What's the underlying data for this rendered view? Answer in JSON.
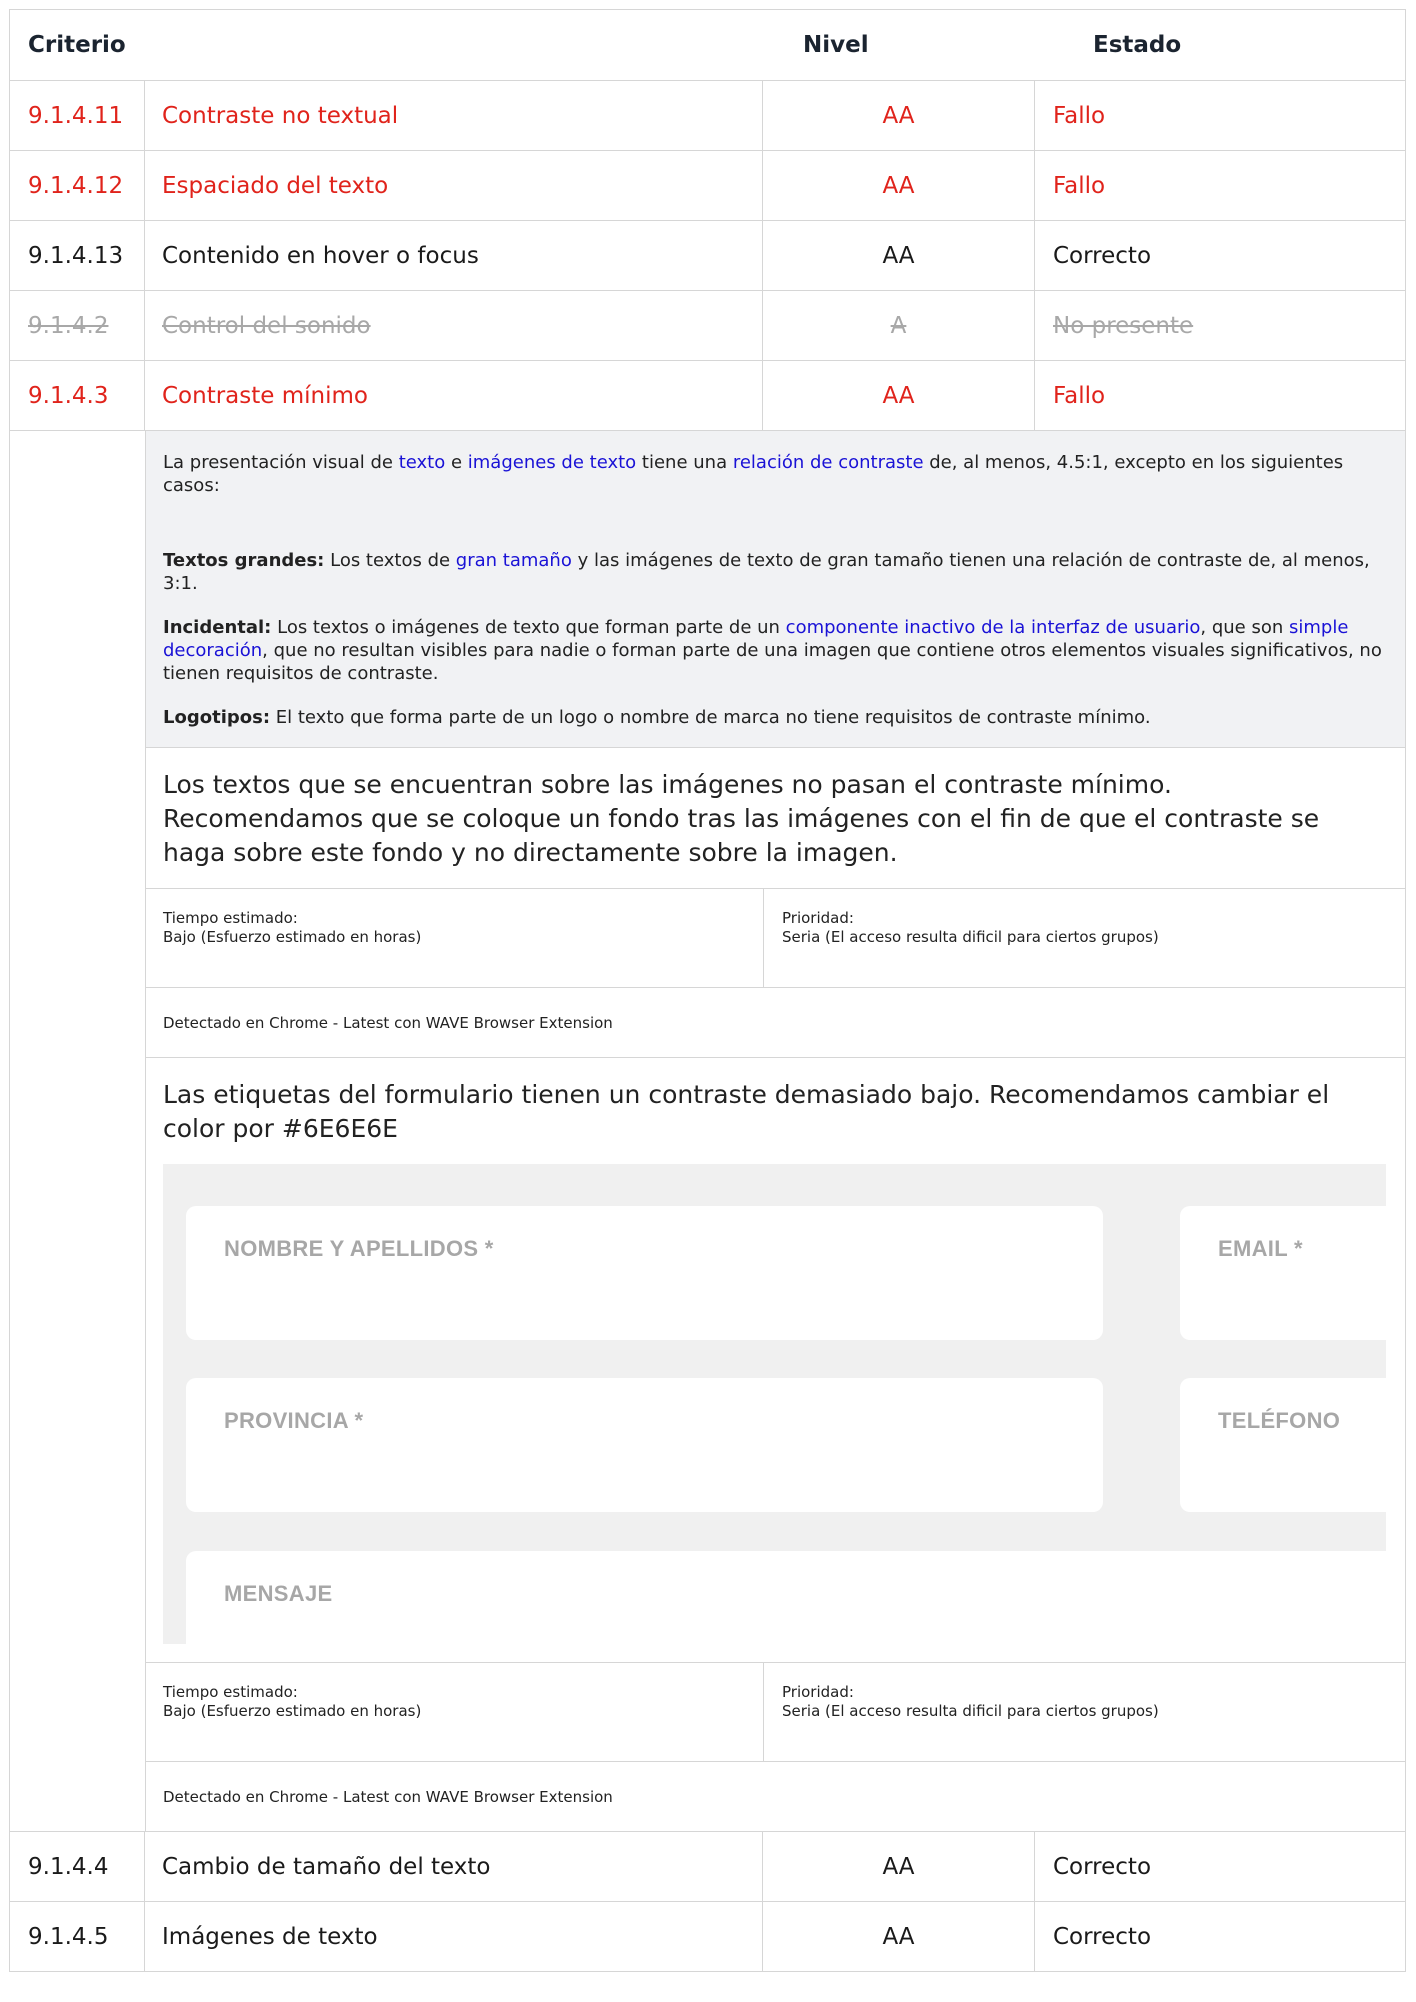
{
  "header": {
    "criterio": "Criterio",
    "nivel": "Nivel",
    "estado": "Estado"
  },
  "rows_top": [
    {
      "id": "9.1.4.11",
      "name": "Contraste no textual",
      "level": "AA",
      "status": "Fallo"
    },
    {
      "id": "9.1.4.12",
      "name": "Espaciado del texto",
      "level": "AA",
      "status": "Fallo"
    },
    {
      "id": "9.1.4.13",
      "name": "Contenido en hover o focus",
      "level": "AA",
      "status": "Correcto"
    },
    {
      "id": "9.1.4.2",
      "name": "Control del sonido",
      "level": "A",
      "status": "No presente"
    },
    {
      "id": "9.1.4.3",
      "name": "Contraste mínimo",
      "level": "AA",
      "status": "Fallo"
    }
  ],
  "criterion_desc": {
    "p1_a": "La presentación visual de ",
    "p1_link1": "texto",
    "p1_b": " e ",
    "p1_link2": "imágenes de texto",
    "p1_c": " tiene una ",
    "p1_link3": "relación de contraste",
    "p1_d": " de, al menos, 4.5:1, excepto en los siguientes casos:",
    "p2_strong": "Textos grandes:",
    "p2_a": " Los textos de ",
    "p2_link": "gran tamaño",
    "p2_b": " y las imágenes de texto de gran tamaño tienen una relación de contraste de, al menos, 3:1.",
    "p3_strong": "Incidental:",
    "p3_a": " Los textos o imágenes de texto que forman parte de un ",
    "p3_link1": "componente inactivo de la interfaz de usuario",
    "p3_b": ", que son ",
    "p3_link2": "simple decoración",
    "p3_c": ", que no resultan visibles para nadie o forman parte de una imagen que contiene otros elementos visuales significativos, no tienen requisitos de contraste.",
    "p4_strong": "Logotipos:",
    "p4_a": " El texto que forma parte de un logo o nombre de marca no tiene requisitos de contraste mínimo."
  },
  "issue1": {
    "text": "Los textos que se encuentran sobre las imágenes no pasan el contraste mínimo. Recomendamos que se coloque un fondo tras las imágenes con el fin de que el contraste se haga sobre este fondo y no directamente sobre la imagen.",
    "time_label": "Tiempo estimado:",
    "time_value": "Bajo (Esfuerzo estimado en horas)",
    "priority_label": "Prioridad:",
    "priority_value": "Seria (El acceso resulta dificil para ciertos grupos)",
    "detected": "Detectado en Chrome - Latest con WAVE Browser Extension"
  },
  "issue2": {
    "text": "Las etiquetas del formulario tienen un contraste demasiado bajo. Recomendamos cambiar el color por #6E6E6E",
    "form_labels": {
      "nombre": "NOMBRE Y APELLIDOS *",
      "email": "EMAIL *",
      "provincia": "PROVINCIA *",
      "telefono": "TELÉFONO",
      "mensaje": "MENSAJE"
    },
    "time_label": "Tiempo estimado:",
    "time_value": "Bajo (Esfuerzo estimado en horas)",
    "priority_label": "Prioridad:",
    "priority_value": "Seria (El acceso resulta dificil para ciertos grupos)",
    "detected": "Detectado en Chrome - Latest con WAVE Browser Extension"
  },
  "rows_bottom": [
    {
      "id": "9.1.4.4",
      "name": "Cambio de tamaño del texto",
      "level": "AA",
      "status": "Correcto"
    },
    {
      "id": "9.1.4.5",
      "name": "Imágenes de texto",
      "level": "AA",
      "status": "Correcto"
    }
  ],
  "colors": {
    "fail": "#e0231b",
    "link": "#1a12d6",
    "not_present": "#a8a8a8",
    "label_gray": "#a7a7a7"
  }
}
